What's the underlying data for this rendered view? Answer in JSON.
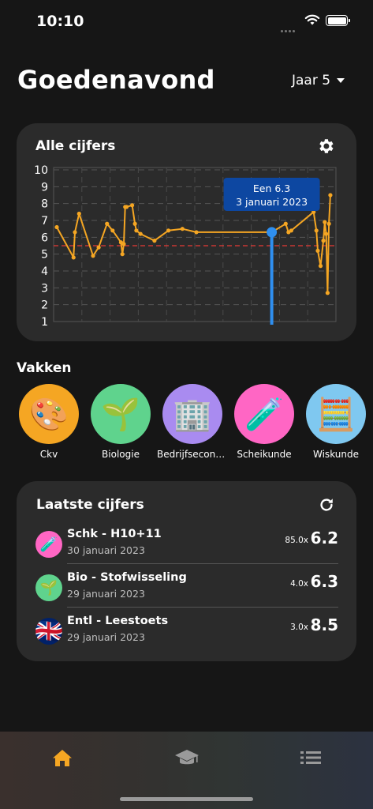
{
  "status_bar": {
    "time": "10:10"
  },
  "header": {
    "greeting": "Goedenavond",
    "year_label": "Jaar 5"
  },
  "chart_card": {
    "title": "Alle cijfers",
    "tooltip": {
      "line1": "Een 6.3",
      "line2": "3 januari 2023"
    }
  },
  "chart_data": {
    "type": "line",
    "title": "Alle cijfers",
    "ylim": [
      1,
      10
    ],
    "y_ticks": [
      1,
      2,
      3,
      4,
      5,
      6,
      7,
      8,
      9,
      10
    ],
    "threshold": 5.5,
    "x": [
      0,
      0.06,
      0.065,
      0.08,
      0.13,
      0.15,
      0.18,
      0.2,
      0.23,
      0.235,
      0.24,
      0.245,
      0.25,
      0.27,
      0.28,
      0.285,
      0.3,
      0.35,
      0.4,
      0.45,
      0.5,
      0.77,
      0.82,
      0.83,
      0.84,
      0.92,
      0.93,
      0.935,
      0.945,
      0.955,
      0.96,
      0.965,
      0.97,
      0.975,
      0.98
    ],
    "values": [
      6.6,
      4.8,
      6.3,
      7.4,
      4.9,
      5.4,
      6.8,
      6.4,
      5.7,
      5.0,
      5.6,
      7.8,
      7.8,
      7.9,
      6.8,
      6.4,
      6.2,
      5.8,
      6.4,
      6.5,
      6.3,
      6.3,
      6.8,
      6.3,
      6.4,
      7.5,
      6.4,
      5.2,
      4.3,
      5.8,
      6.9,
      6.2,
      2.7,
      6.8,
      8.5
    ],
    "highlight": {
      "value": 6.3,
      "x": 0.77,
      "label": "Een 6.3",
      "date": "3 januari 2023"
    },
    "grid": true
  },
  "subjects": {
    "title": "Vakken",
    "items": [
      {
        "name": "Ckv",
        "color": "#f5a623",
        "emoji": "🎨"
      },
      {
        "name": "Biologie",
        "color": "#5fd38d",
        "emoji": "🌱"
      },
      {
        "name": "Bedrijfseconomie",
        "color": "#a98bf0",
        "emoji": "🏢"
      },
      {
        "name": "Scheikunde",
        "color": "#ff66c4",
        "emoji": "🧪"
      },
      {
        "name": "Wiskunde",
        "color": "#7fc8f0",
        "emoji": "🧮"
      }
    ]
  },
  "recent": {
    "title": "Laatste cijfers",
    "items": [
      {
        "title": "Schk - H10+11",
        "date": "30 januari 2023",
        "weight": "85.0x",
        "grade": "6.2",
        "color": "#ff66c4",
        "emoji": "🧪"
      },
      {
        "title": "Bio - Stofwisseling",
        "date": "29 januari 2023",
        "weight": "4.0x",
        "grade": "6.3",
        "color": "#5fd38d",
        "emoji": "🌱"
      },
      {
        "title": "Entl - Leestoets",
        "date": "29 januari 2023",
        "weight": "3.0x",
        "grade": "8.5",
        "color": "#012169",
        "emoji": "🇬🇧"
      }
    ]
  },
  "tab_bar": {
    "tabs": [
      {
        "icon": "home-icon",
        "active": true
      },
      {
        "icon": "graduation-cap-icon",
        "active": false
      },
      {
        "icon": "list-icon",
        "active": false
      }
    ],
    "active_color": "#f5a623"
  }
}
